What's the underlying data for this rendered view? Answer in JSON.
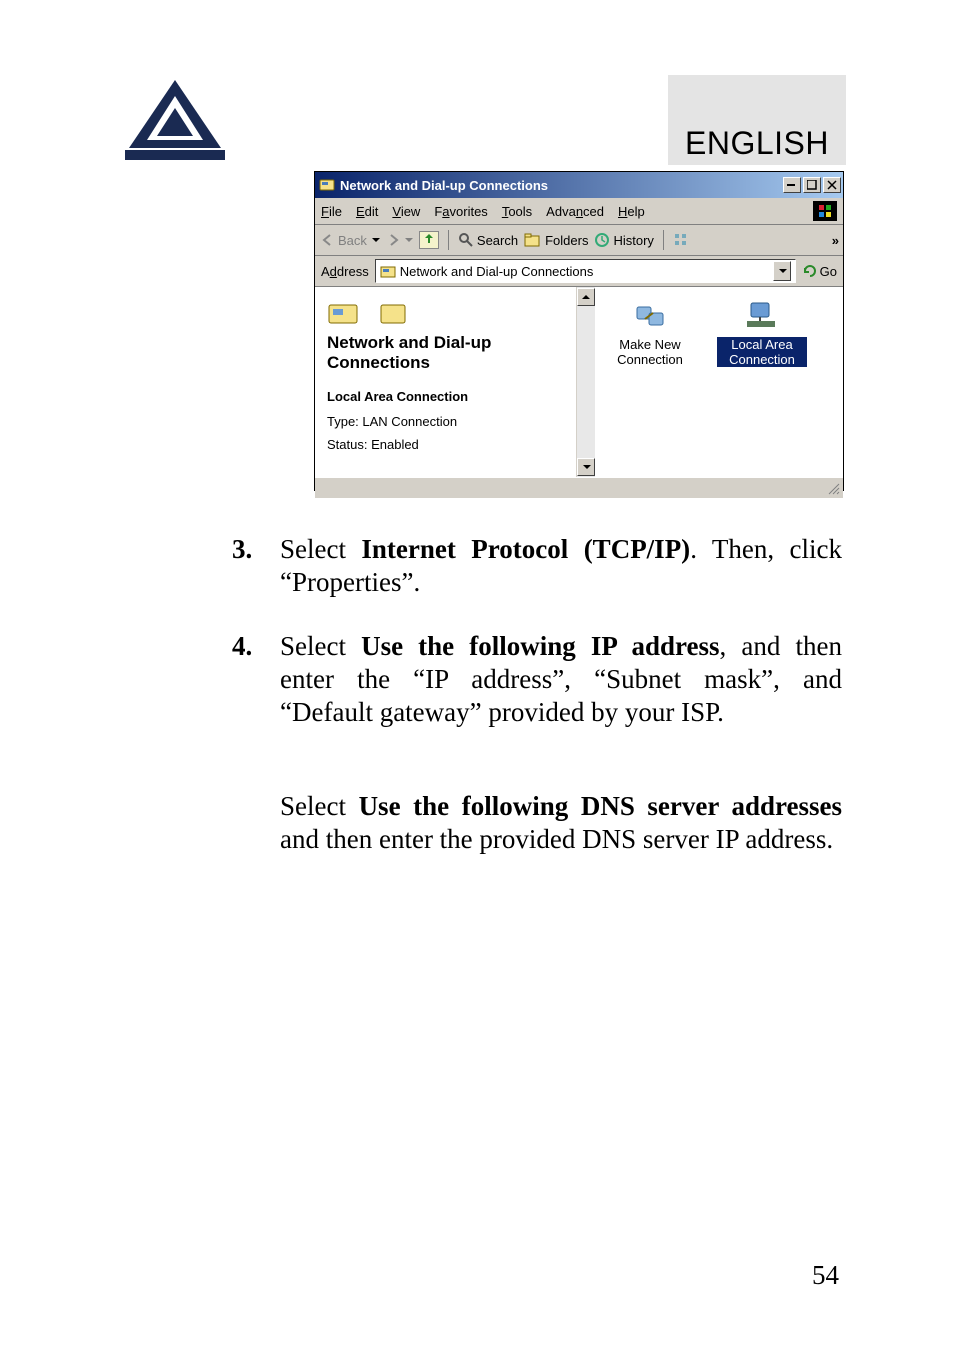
{
  "header": {
    "language": "ENGLISH"
  },
  "window": {
    "title": "Network and Dial-up Connections",
    "menubar": {
      "file": "File",
      "edit": "Edit",
      "view": "View",
      "favorites": "Favorites",
      "tools": "Tools",
      "advanced": "Advanced",
      "help": "Help"
    },
    "toolbar": {
      "back": "Back",
      "search": "Search",
      "folders": "Folders",
      "history": "History",
      "overflow": "»"
    },
    "addressbar": {
      "label": "Address",
      "value": "Network and Dial-up Connections",
      "go": "Go"
    },
    "leftpane": {
      "title": "Network and Dial-up Connections",
      "subtitle": "Local Area Connection",
      "type": "Type: LAN Connection",
      "status": "Status: Enabled"
    },
    "items": [
      {
        "label": "Make New Connection",
        "selected": false
      },
      {
        "label": "Local Area Connection",
        "selected": true
      }
    ]
  },
  "instructions": {
    "step3_num": "3.",
    "step3_text_a": "Select ",
    "step3_bold": "Internet Protocol (TCP/IP)",
    "step3_text_b": ". Then, click “Properties”.",
    "step4_num": "4.",
    "step4_text_a": "Select ",
    "step4_bold": "Use the following IP address",
    "step4_text_b": ", and then enter the “IP address”, “Subnet mask”, and “Default gateway” provided by your ISP.",
    "step5_text_a": "Select ",
    "step5_bold": "Use the following DNS server addresses",
    "step5_text_b": " and then enter the provided DNS server IP address."
  },
  "page_number": "54"
}
